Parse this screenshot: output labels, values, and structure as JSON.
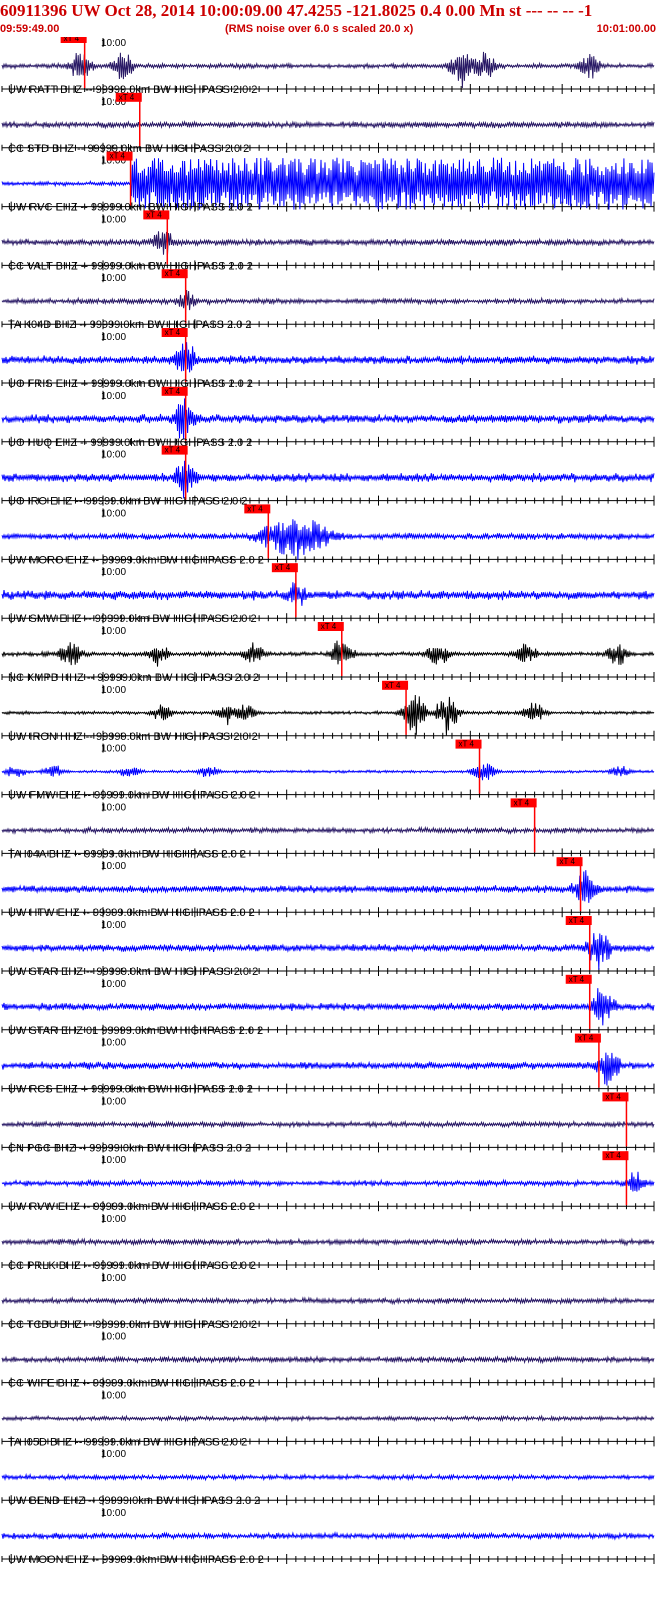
{
  "header": {
    "title": "60911396 UW Oct 28, 2014 10:00:09.00   47.4255 -121.8025  0.4 0.00 Mn st --- -- --  -1",
    "start_time": "09:59:49.00",
    "rms_note": "(RMS noise over 6.0 s scaled 20.0 x)",
    "end_time": "10:01:00.00",
    "tick_label": "10:00",
    "pick_label": "xT 4"
  },
  "chart_data": {
    "type": "seismogram",
    "title": "60911396 UW Oct 28, 2014 10:00:09.00   47.4255 -121.8025  0.4 0.00 Mn st --- -- --  -1",
    "x_start": "09:59:49.00",
    "x_end": "10:01:00.00",
    "x_range_seconds": [
      0,
      71
    ],
    "tick_interval_seconds": 1,
    "labeled_tick": "10:00",
    "traces": [
      {
        "label": "UW RATT BHZ -- 99999.0km BW  HIGHPASS  2.0  2",
        "color": "#2a1a66",
        "pick_s": 9.0,
        "bursts": [
          [
            8.5,
            0.8
          ],
          [
            13.2,
            0.7
          ],
          [
            50.0,
            0.9
          ],
          [
            52.5,
            0.7
          ],
          [
            64.0,
            0.6
          ]
        ],
        "noise": 0.22
      },
      {
        "label": "CC STD BHZ -- 99999.0km BW  HIGHPASS  2.0  2",
        "color": "#2a1a66",
        "pick_s": 15.0,
        "bursts": [],
        "noise": 0.28
      },
      {
        "label": "UW RVC EHZ -- 99999.0km BW  HIGHPASS  2.0  2",
        "color": "#0000ff",
        "pick_s": 14.0,
        "bursts": [],
        "noise": 0.2,
        "saturated_from_s": 14.0
      },
      {
        "label": "CC VALT BHZ -- 99999.0km BW  HIGHPASS  2.0  2",
        "color": "#2a1a66",
        "pick_s": 18.0,
        "bursts": [
          [
            17.5,
            0.6
          ]
        ],
        "noise": 0.3
      },
      {
        "label": "TA K04D BHZ -- 99999.0km BW  HIGHPASS  2.0  2",
        "color": "#2a1a66",
        "pick_s": 20.0,
        "bursts": [
          [
            20.2,
            0.5
          ]
        ],
        "noise": 0.25
      },
      {
        "label": "UO FRIS EHZ -- 99999.0km BW  HIGHPASS  2.0  2",
        "color": "#0000ff",
        "pick_s": 20.0,
        "bursts": [
          [
            19.9,
            1.0
          ]
        ],
        "noise": 0.4
      },
      {
        "label": "UO HUQ EHZ -- 99999.0km BW  HIGHPASS  2.0  2",
        "color": "#0000ff",
        "pick_s": 20.0,
        "bursts": [
          [
            19.9,
            1.0
          ]
        ],
        "noise": 0.42
      },
      {
        "label": "UO IRO EHZ -- 99999.0km BW  HIGHPASS  2.0  2",
        "color": "#0000ff",
        "pick_s": 20.0,
        "bursts": [
          [
            20.0,
            1.0
          ]
        ],
        "noise": 0.42
      },
      {
        "label": "UW MORO EHZ -- 99999.0km BW  HIGHPASS  2.0  2",
        "color": "#0000ff",
        "pick_s": 29.0,
        "bursts": [
          [
            32.0,
            1.0
          ]
        ],
        "noise": 0.3,
        "wide_burst": true
      },
      {
        "label": "UW SMW EHZ -- 99999.0km BW  HIGHPASS  2.0  2",
        "color": "#0000ff",
        "pick_s": 32.0,
        "bursts": [
          [
            32.0,
            0.6
          ]
        ],
        "noise": 0.45
      },
      {
        "label": "NC KMPB HHZ -- 99999.0km BW  HIGHPASS  2.0  2",
        "color": "#000000",
        "pick_s": 37.0,
        "bursts": [
          [
            7.5,
            0.6
          ],
          [
            17.0,
            0.5
          ],
          [
            27.5,
            0.5
          ],
          [
            37.0,
            0.7
          ],
          [
            47.5,
            0.6
          ],
          [
            57.0,
            0.5
          ],
          [
            67.0,
            0.5
          ]
        ],
        "noise": 0.2
      },
      {
        "label": "UW IRON HHZ -- 99999.0km BW  HIGHPASS  2.0  2",
        "color": "#000000",
        "pick_s": 44.0,
        "bursts": [
          [
            17.5,
            0.4
          ],
          [
            24.5,
            0.5
          ],
          [
            26.5,
            0.4
          ],
          [
            44.8,
            1.0
          ],
          [
            48.5,
            0.9
          ],
          [
            58.0,
            0.5
          ]
        ],
        "noise": 0.15
      },
      {
        "label": "UW FMW EHZ -- 99999.0km BW  HIGHPASS  2.0  2",
        "color": "#0000ff",
        "pick_s": 52.0,
        "bursts": [
          [
            1.5,
            0.3
          ],
          [
            5.5,
            0.3
          ],
          [
            14.0,
            0.3
          ],
          [
            22.5,
            0.3
          ],
          [
            52.5,
            0.5
          ],
          [
            67.5,
            0.3
          ]
        ],
        "noise": 0.12
      },
      {
        "label": "TA I04A BHZ -- 99999.0km BW  HIGHPASS  2.0  2",
        "color": "#2a1a66",
        "pick_s": 58.0,
        "bursts": [],
        "noise": 0.25
      },
      {
        "label": "UW HTW EHZ -- 99999.0km BW  HIGHPASS  2.0  2",
        "color": "#0000ff",
        "pick_s": 63.0,
        "bursts": [
          [
            63.5,
            1.0
          ]
        ],
        "noise": 0.35
      },
      {
        "label": "UW STAR EHZ -- 99999.0km BW  HIGHPASS  2.0  2",
        "color": "#0000ff",
        "pick_s": 64.0,
        "bursts": [
          [
            65.0,
            1.0
          ]
        ],
        "noise": 0.35
      },
      {
        "label": "UW STAR EHZ 01 99999.0km BW  HIGHPASS  2.0  2",
        "color": "#0000ff",
        "pick_s": 64.0,
        "bursts": [
          [
            65.5,
            1.0
          ]
        ],
        "noise": 0.35
      },
      {
        "label": "UW RCS EHZ -- 99999.0km BW  HIGHPASS  2.0  2",
        "color": "#0000ff",
        "pick_s": 65.0,
        "bursts": [
          [
            66.0,
            1.0
          ]
        ],
        "noise": 0.35
      },
      {
        "label": "CN PGC BHZ -- 99999.0km BW  HIGHPASS  2.0  2",
        "color": "#2a1a66",
        "pick_s": 68.0,
        "bursts": [],
        "noise": 0.25
      },
      {
        "label": "UW RVW EHZ -- 99999.0km BW  HIGHPASS  2.0  2",
        "color": "#0000ff",
        "pick_s": 68.0,
        "bursts": [
          [
            69.0,
            0.5
          ]
        ],
        "noise": 0.25
      },
      {
        "label": "CC PRLK BHZ -- 99999.0km BW  HIGHPASS  2.0  2",
        "color": "#2a1a66",
        "pick_s": null,
        "bursts": [],
        "noise": 0.25
      },
      {
        "label": "CC TCBU BHZ -- 99999.0km BW  HIGHPASS  2.0  2",
        "color": "#2a1a66",
        "pick_s": null,
        "bursts": [],
        "noise": 0.25
      },
      {
        "label": "CC WIFE BHZ -- 99999.0km BW  HIGHPASS  2.0  2",
        "color": "#2a1a66",
        "pick_s": null,
        "bursts": [],
        "noise": 0.28
      },
      {
        "label": "TA I05D BHZ -- 99999.0km BW  HIGHPASS  2.0  2",
        "color": "#2a1a66",
        "pick_s": null,
        "bursts": [],
        "noise": 0.2
      },
      {
        "label": "UW BEND EHZ -- 99999.0km BW  HIGHPASS  2.0  2",
        "color": "#0000ff",
        "pick_s": null,
        "bursts": [],
        "noise": 0.22
      },
      {
        "label": "UW MOON EHZ -- 99999.0km BW  HIGHPASS  2.0  2",
        "color": "#0000ff",
        "pick_s": null,
        "bursts": [],
        "noise": 0.28
      }
    ]
  },
  "colors": {
    "title": "#cc0000",
    "pick_marker": "#ff0000",
    "axis": "#000000"
  }
}
